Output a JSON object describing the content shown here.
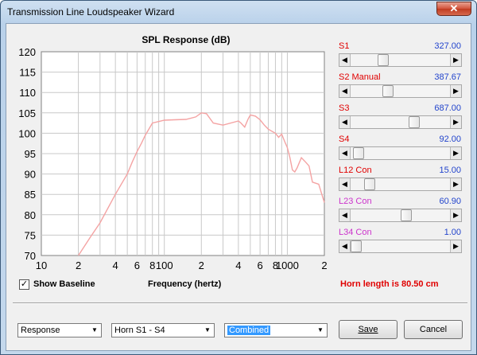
{
  "window": {
    "title": "Transmission Line Loudspeaker Wizard",
    "close_glyph": "✕"
  },
  "chart_data": {
    "type": "line",
    "title": "SPL Response (dB)",
    "xlabel": "Frequency (hertz)",
    "ylabel": "",
    "x_scale": "log",
    "xlim": [
      10,
      2000
    ],
    "ylim": [
      70,
      120
    ],
    "yticks": [
      70,
      75,
      80,
      85,
      90,
      95,
      100,
      105,
      110,
      115,
      120
    ],
    "xtick_labels": [
      "10",
      "2",
      "4",
      "6",
      "8",
      "100",
      "2",
      "4",
      "6",
      "8",
      "1000",
      "2"
    ],
    "grid": true,
    "series": [
      {
        "color": "#f4a3a3",
        "x": [
          20,
          25,
          30,
          40,
          50,
          55,
          60,
          65,
          70,
          80,
          100,
          120,
          150,
          180,
          200,
          220,
          250,
          300,
          400,
          420,
          450,
          480,
          500,
          550,
          600,
          650,
          700,
          800,
          850,
          900,
          950,
          1000,
          1050,
          1100,
          1150,
          1200,
          1300,
          1400,
          1500,
          1600,
          1800,
          2000
        ],
        "y": [
          70,
          74.5,
          78,
          85,
          90,
          93,
          95.5,
          97.5,
          99.5,
          102.5,
          103.2,
          103.3,
          103.4,
          104.0,
          105.0,
          104.8,
          102.5,
          102.0,
          103.0,
          102.5,
          101.5,
          103.5,
          104.5,
          104.2,
          103.3,
          102.0,
          101.0,
          100.0,
          99.0,
          99.8,
          98.0,
          96.5,
          94.0,
          91.0,
          90.5,
          91.5,
          94.0,
          93.0,
          92.0,
          88.0,
          87.5,
          83.0
        ]
      }
    ]
  },
  "baseline": {
    "label": "Show Baseline",
    "checked": true,
    "check_glyph": "✓"
  },
  "horn_length": "Horn length is 80.50 cm",
  "sliders": [
    {
      "name": "S1",
      "value": "327.00",
      "name_color": "#e00000",
      "position": 0.31
    },
    {
      "name": "S2  Manual",
      "value": "387.67",
      "name_color": "#e00000",
      "position": 0.36
    },
    {
      "name": "S3",
      "value": "687.00",
      "name_color": "#e00000",
      "position": 0.66
    },
    {
      "name": "S4",
      "value": "92.00",
      "name_color": "#e00000",
      "position": 0.03
    },
    {
      "name": "L12  Con",
      "value": "15.00",
      "name_color": "#e00000",
      "position": 0.15
    },
    {
      "name": "L23  Con",
      "value": "60.90",
      "name_color": "#cc33cc",
      "position": 0.57
    },
    {
      "name": "L34  Con",
      "value": "1.00",
      "name_color": "#cc33cc",
      "position": 0.0
    }
  ],
  "controls": {
    "combo_response": "Response",
    "combo_horn": "Horn S1 - S4",
    "combo_combined": "Combined",
    "save_label": "Save",
    "cancel_label": "Cancel",
    "arrow_glyph": "▼"
  }
}
